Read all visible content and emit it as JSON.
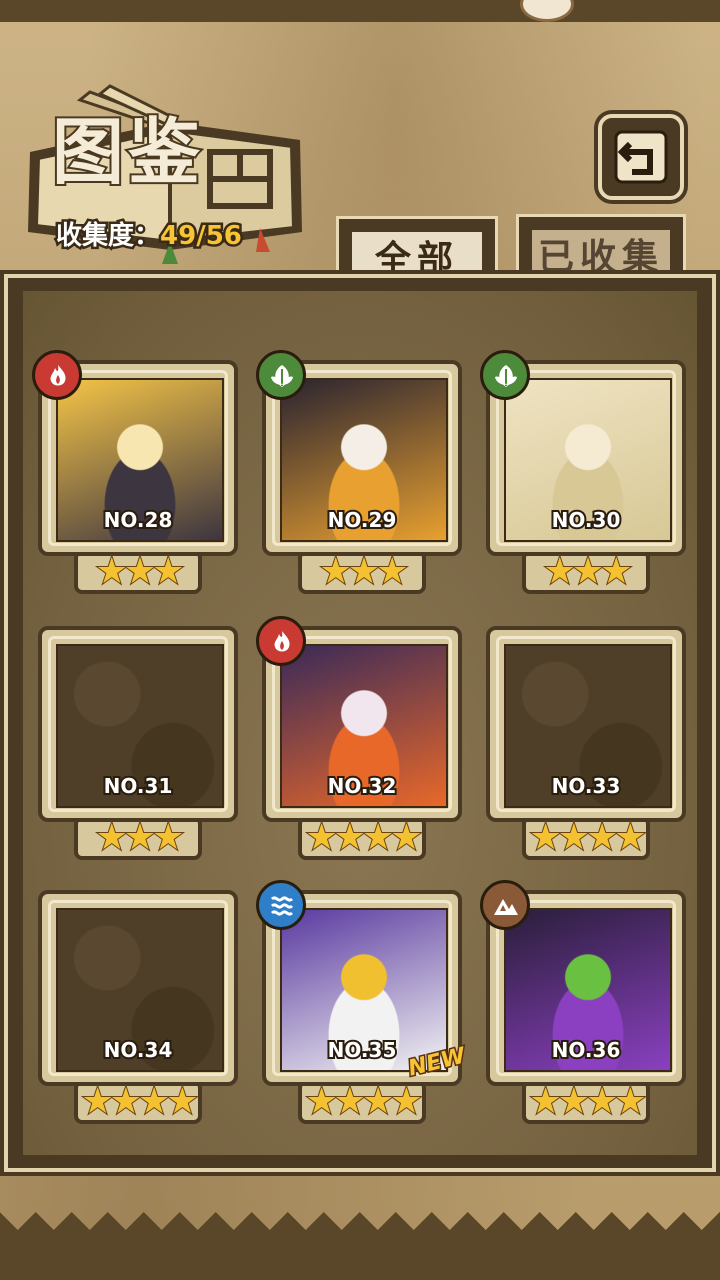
{
  "header": {
    "title": "图鉴",
    "collect_label": "收集度：",
    "collect_value": "49/56"
  },
  "tabs": [
    {
      "label": "全部",
      "active": true
    },
    {
      "label": "已收集",
      "active": false
    }
  ],
  "cards": [
    {
      "number": "NO.28",
      "stars": "★★★",
      "element": "fire-icon",
      "unlocked": true,
      "colors": [
        "#f4c447",
        "#3d3540",
        "#f7e6b0"
      ]
    },
    {
      "number": "NO.29",
      "stars": "★★★",
      "element": "leaf-icon",
      "unlocked": true,
      "colors": [
        "#2a2430",
        "#e8a030",
        "#f4eee6"
      ]
    },
    {
      "number": "NO.30",
      "stars": "★★★",
      "element": "leaf-icon",
      "unlocked": true,
      "colors": [
        "#efe3c2",
        "#d8c896",
        "#f5ebd2"
      ]
    },
    {
      "number": "NO.31",
      "stars": "★★★",
      "element": null,
      "unlocked": false,
      "colors": [
        "#4f3f28"
      ]
    },
    {
      "number": "NO.32",
      "stars": "★★★★",
      "element": "fire-icon",
      "unlocked": true,
      "colors": [
        "#3a2a58",
        "#e8682a",
        "#f2e6ee"
      ]
    },
    {
      "number": "NO.33",
      "stars": "★★★★",
      "element": null,
      "unlocked": false,
      "colors": [
        "#4f3f28"
      ]
    },
    {
      "number": "NO.34",
      "stars": "★★★★",
      "element": null,
      "unlocked": false,
      "colors": [
        "#4f3f28"
      ]
    },
    {
      "number": "NO.35",
      "stars": "★★★★",
      "element": "water-icon",
      "unlocked": true,
      "new_label": "NEW",
      "colors": [
        "#5a3aa0",
        "#f2f2f2",
        "#f0c030"
      ]
    },
    {
      "number": "NO.36",
      "stars": "★★★★",
      "element": "earth-icon",
      "unlocked": true,
      "colors": [
        "#2a1e3a",
        "#8a40c0",
        "#6ac040"
      ]
    }
  ]
}
